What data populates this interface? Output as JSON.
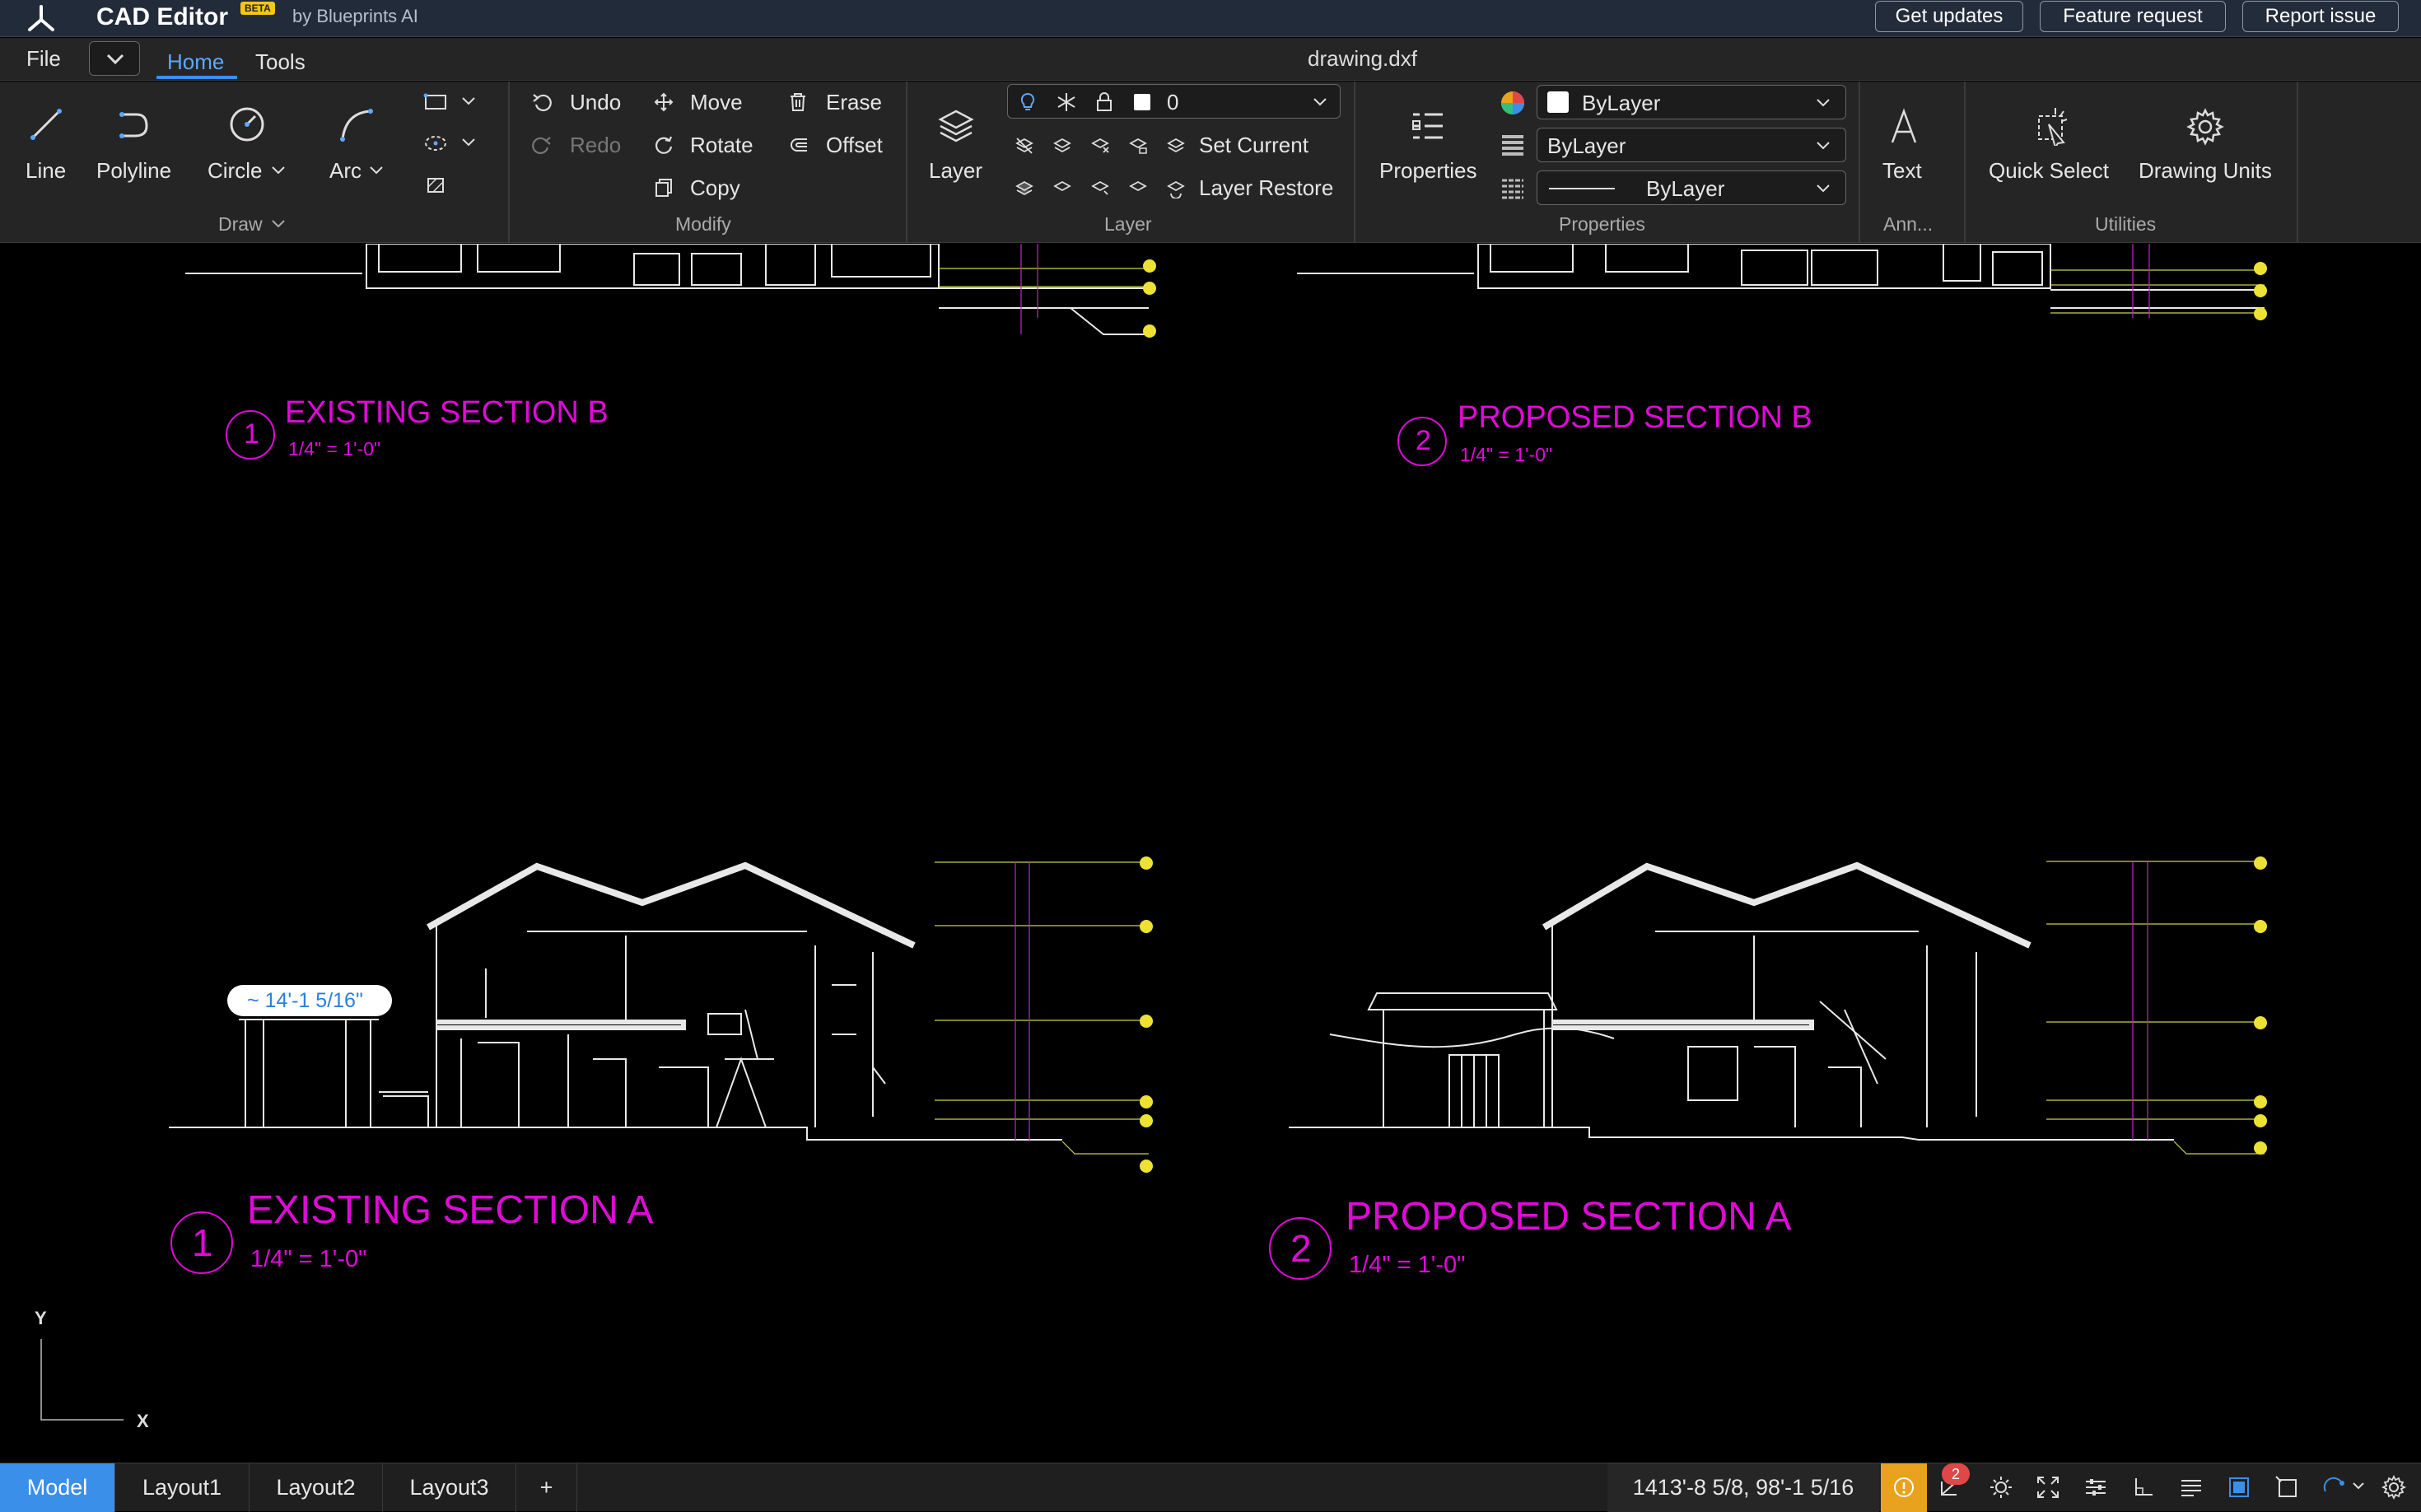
{
  "titlebar": {
    "app_name": "CAD Editor",
    "beta_badge": "BETA",
    "byline": "by Blueprints AI",
    "buttons": {
      "get_updates": "Get updates",
      "feature_request": "Feature request",
      "report_issue": "Report issue"
    }
  },
  "menubar": {
    "file": "File",
    "tab_home": "Home",
    "tab_tools": "Tools",
    "filename": "drawing.dxf"
  },
  "ribbon": {
    "draw": {
      "group_label": "Draw",
      "line": "Line",
      "polyline": "Polyline",
      "circle": "Circle",
      "arc": "Arc"
    },
    "modify": {
      "group_label": "Modify",
      "undo": "Undo",
      "redo": "Redo",
      "move": "Move",
      "rotate": "Rotate",
      "copy": "Copy",
      "erase": "Erase",
      "offset": "Offset"
    },
    "layer": {
      "group_label": "Layer",
      "layer": "Layer",
      "current_layer": "0",
      "set_current": "Set Current",
      "layer_restore": "Layer Restore"
    },
    "properties": {
      "group_label": "Properties",
      "properties": "Properties",
      "color": "ByLayer",
      "lineweight": "ByLayer",
      "linetype": "ByLayer"
    },
    "annotation": {
      "group_label": "Ann...",
      "text": "Text"
    },
    "utilities": {
      "group_label": "Utilities",
      "quick_select": "Quick Select",
      "drawing_units": "Drawing Units"
    }
  },
  "canvas": {
    "section_b_existing": {
      "number": "1",
      "title": "EXISTING SECTION B",
      "scale": "1/4\" = 1'-0\""
    },
    "section_b_proposed": {
      "number": "2",
      "title": "PROPOSED SECTION B",
      "scale": "1/4\" = 1'-0\""
    },
    "section_a_existing": {
      "number": "1",
      "title": "EXISTING SECTION A",
      "scale": "1/4\" = 1'-0\""
    },
    "section_a_proposed": {
      "number": "2",
      "title": "PROPOSED SECTION A",
      "scale": "1/4\" = 1'-0\""
    },
    "measure_tooltip": "~ 14'-1 5/16\"",
    "axis_y": "Y",
    "axis_x": "X"
  },
  "statusbar": {
    "tabs": [
      "Model",
      "Layout1",
      "Layout2",
      "Layout3",
      "+"
    ],
    "coordinates": "1413'-8 5/8, 98'-1 5/16",
    "notification_count": "2"
  },
  "colors": {
    "accent": "#3a8fe8",
    "annotation": "#e00ad8",
    "titlebar": "#222b3a",
    "warning": "#e8a21e"
  }
}
